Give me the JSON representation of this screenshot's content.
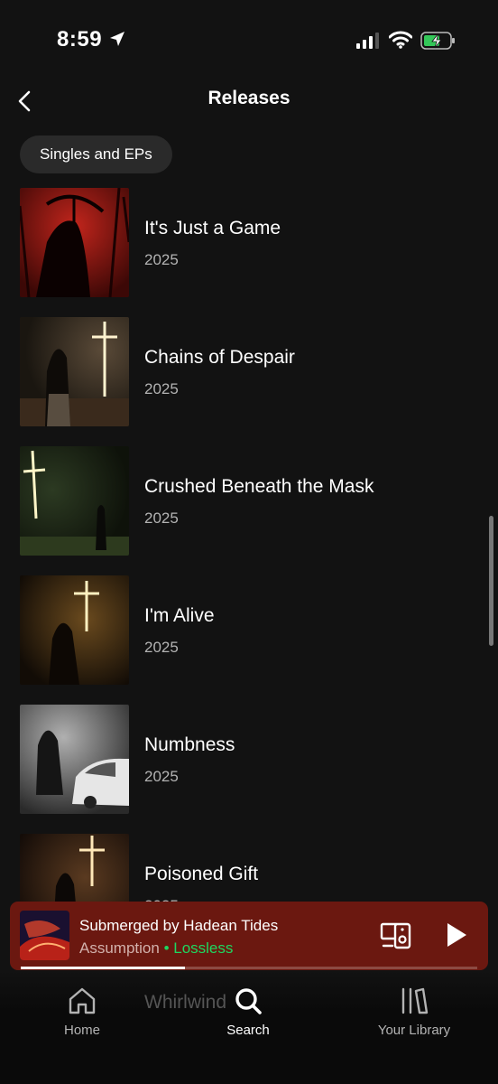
{
  "status_bar": {
    "time": "8:59",
    "icons": [
      "location-arrow-icon",
      "cellular-signal-icon",
      "wifi-icon",
      "battery-charging-icon"
    ]
  },
  "header": {
    "title": "Releases",
    "back_icon": "chevron-left-icon"
  },
  "filter": {
    "chip_label": "Singles and EPs"
  },
  "releases": [
    {
      "title": "It's Just a Game",
      "year": "2025"
    },
    {
      "title": "Chains of Despair",
      "year": "2025"
    },
    {
      "title": "Crushed Beneath the Mask",
      "year": "2025"
    },
    {
      "title": "I'm Alive",
      "year": "2025"
    },
    {
      "title": "Numbness",
      "year": "2025"
    },
    {
      "title": "Poisoned Gift",
      "year": "2025"
    }
  ],
  "partially_hidden_row": "Whirlwind",
  "now_playing": {
    "track": "Submerged by Hadean Tides",
    "artist": "Assumption",
    "separator": "•",
    "quality": "Lossless",
    "progress_fraction": 0.36,
    "accent_color": "#6b1810",
    "quality_color": "#1ed760"
  },
  "nav": {
    "home": "Home",
    "search": "Search",
    "library": "Your Library",
    "active": "search"
  },
  "colors": {
    "background": "#121212",
    "chip": "#2a2a2a",
    "secondary_text": "#b3b3b3"
  }
}
